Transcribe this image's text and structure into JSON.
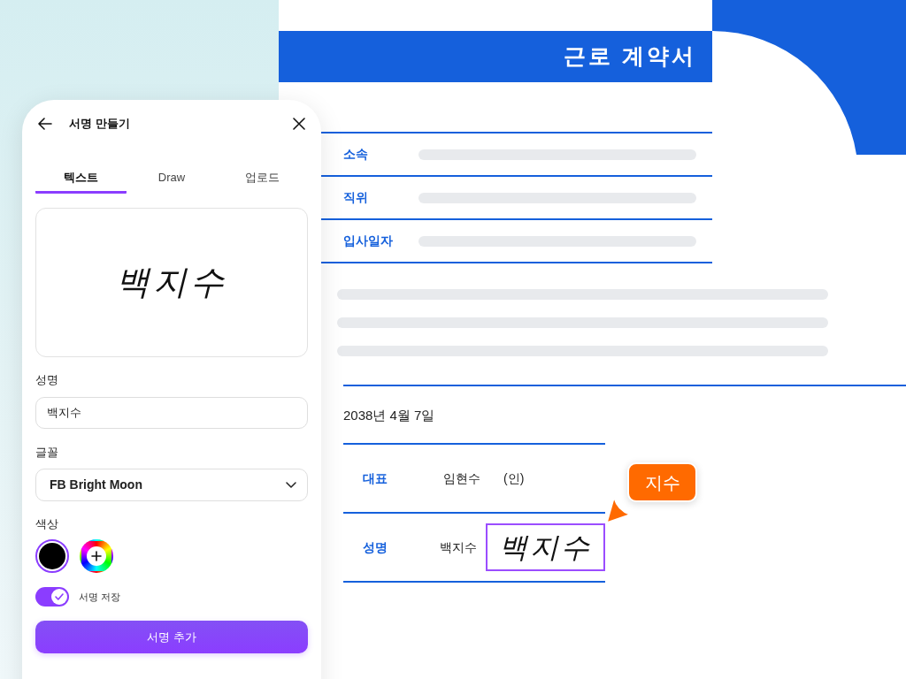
{
  "panel": {
    "title": "서명 만들기",
    "tabs": [
      {
        "label": "텍스트",
        "selected": true
      },
      {
        "label": "Draw",
        "selected": false
      },
      {
        "label": "업로드",
        "selected": false
      }
    ],
    "preview_signature": "백지수",
    "fields": [
      {
        "kind": "input",
        "label": "성명",
        "value": "백지수"
      },
      {
        "kind": "select",
        "label": "글꼴",
        "value": "FB Bright Moon"
      }
    ],
    "color_section": {
      "label": "색상",
      "swatches": [
        {
          "kind": "color",
          "color": "#000000",
          "selected": true
        },
        {
          "kind": "picker",
          "selected": false
        }
      ]
    },
    "save_toggle": {
      "label": "서명 저장",
      "on": true
    },
    "submit_button": {
      "label": "서명 추가"
    }
  },
  "document": {
    "title": "근로 계약서",
    "info_rows": [
      {
        "label": "소속"
      },
      {
        "label": "직위"
      },
      {
        "label": "입사일자"
      }
    ],
    "date": "2038년 4월 7일",
    "signatories": [
      {
        "role": "대표",
        "name": "임현수",
        "seal": "(인)"
      },
      {
        "role": "성명",
        "name": "백지수",
        "signature": "백지수"
      }
    ],
    "collaborator_tag": "지수"
  }
}
